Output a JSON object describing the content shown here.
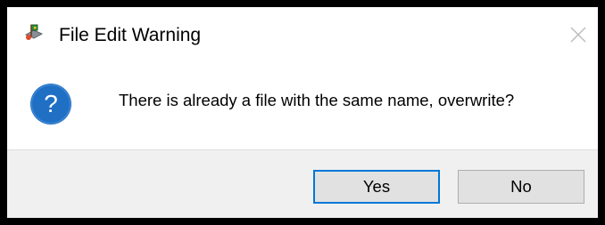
{
  "window": {
    "title": "File Edit Warning",
    "app_icon": "map-pin-app-icon",
    "close_icon": "close-icon"
  },
  "message": {
    "icon": "question-icon",
    "text": "There is already a file with the same name, overwrite?"
  },
  "buttons": {
    "yes_label": "Yes",
    "no_label": "No",
    "default": "yes"
  },
  "colors": {
    "question_icon": "#1f6fc5",
    "default_button_border": "#0078d7",
    "footer_background": "#f0f0f0",
    "button_background": "#e1e1e1"
  }
}
